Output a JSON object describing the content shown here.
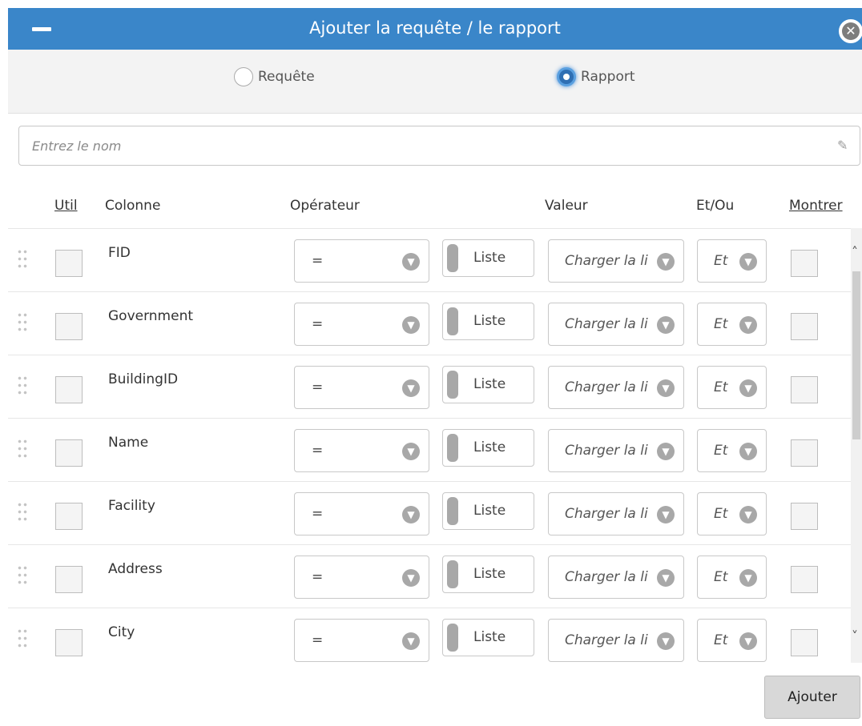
{
  "dialog": {
    "title": "Ajouter la requête / le rapport",
    "close_glyph": "✕",
    "minimize_glyph": "—"
  },
  "mode": {
    "options": [
      "Requête",
      "Rapport"
    ],
    "selected": "Rapport"
  },
  "name_field": {
    "placeholder": "Entrez le nom",
    "value": ""
  },
  "headers": {
    "use": "Util",
    "column": "Colonne",
    "operator": "Opérateur",
    "value": "Valeur",
    "andor": "Et/Ou",
    "show": "Montrer"
  },
  "rows": [
    {
      "column": "FID",
      "operator": "=",
      "mode": "Liste",
      "value": "Charger la li",
      "andor": "Et"
    },
    {
      "column": "Government",
      "operator": "=",
      "mode": "Liste",
      "value": "Charger la li",
      "andor": "Et"
    },
    {
      "column": "BuildingID",
      "operator": "=",
      "mode": "Liste",
      "value": "Charger la li",
      "andor": "Et"
    },
    {
      "column": "Name",
      "operator": "=",
      "mode": "Liste",
      "value": "Charger la li",
      "andor": "Et"
    },
    {
      "column": "Facility",
      "operator": "=",
      "mode": "Liste",
      "value": "Charger la li",
      "andor": "Et"
    },
    {
      "column": "Address",
      "operator": "=",
      "mode": "Liste",
      "value": "Charger la li",
      "andor": "Et"
    },
    {
      "column": "City",
      "operator": "=",
      "mode": "Liste",
      "value": "Charger la li",
      "andor": "Et"
    }
  ],
  "footer": {
    "add_label": "Ajouter"
  },
  "colors": {
    "titlebar": "#3a86c9",
    "radio_selected": "#2f6fb3"
  }
}
